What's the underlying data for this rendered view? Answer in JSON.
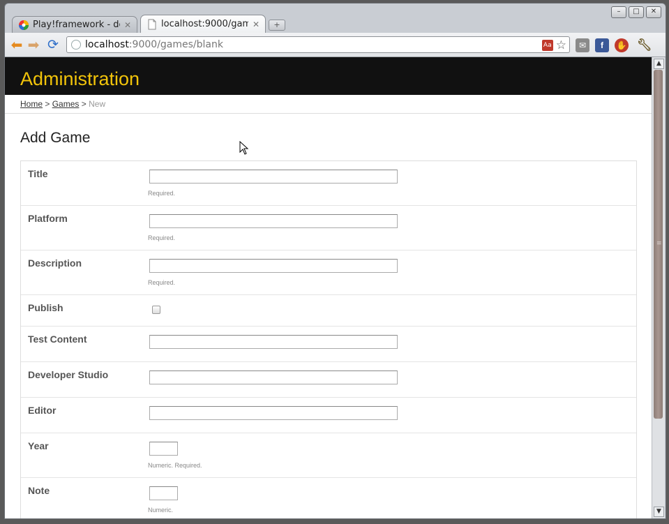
{
  "browser": {
    "tabs": [
      {
        "title": "Play!framework - deu...",
        "active": false
      },
      {
        "title": "localhost:9000/game...",
        "active": true
      }
    ],
    "url_host": "localhost",
    "url_rest": ":9000/games/blank"
  },
  "page": {
    "header_title": "Administration",
    "breadcrumb": {
      "home": "Home",
      "sep": ">",
      "games": "Games",
      "current": "New"
    },
    "title": "Add Game"
  },
  "form": {
    "fields": [
      {
        "label": "Title",
        "type": "text",
        "hint": "Required."
      },
      {
        "label": "Platform",
        "type": "text",
        "hint": "Required."
      },
      {
        "label": "Description",
        "type": "text",
        "hint": "Required."
      },
      {
        "label": "Publish",
        "type": "checkbox",
        "hint": ""
      },
      {
        "label": "Test Content",
        "type": "text",
        "hint": ""
      },
      {
        "label": "Developer Studio",
        "type": "text",
        "hint": ""
      },
      {
        "label": "Editor",
        "type": "text",
        "hint": ""
      },
      {
        "label": "Year",
        "type": "number",
        "hint": "Numeric. Required."
      },
      {
        "label": "Note",
        "type": "number",
        "hint": "Numeric."
      }
    ]
  },
  "colors": {
    "header_bg": "#111111",
    "header_text": "#f2c40a"
  }
}
